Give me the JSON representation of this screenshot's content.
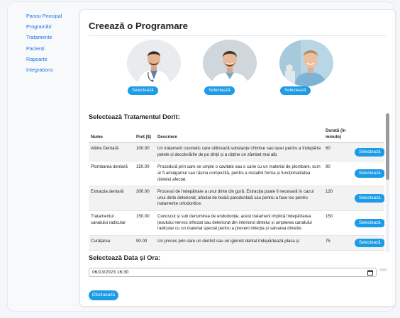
{
  "sidebar": {
    "items": [
      {
        "label": "Panou Principal"
      },
      {
        "label": "Programări"
      },
      {
        "label": "Tratamente"
      },
      {
        "label": "Pacienți"
      },
      {
        "label": "Rapoarte"
      },
      {
        "label": "Integrations"
      }
    ]
  },
  "main": {
    "title": "Creează o Programare",
    "doctors": [
      {
        "select_label": "Selectează"
      },
      {
        "select_label": "Selectează"
      },
      {
        "select_label": "Selectează"
      }
    ],
    "treatments": {
      "heading": "Selectează Tratamentul Dorit:",
      "columns": {
        "name": "Nume",
        "price": "Preț ($)",
        "description": "Descriere",
        "duration": "Durată (în minute)"
      },
      "rows": [
        {
          "name": "Albire Dentară",
          "price": "100.00",
          "description": "Un tratament cosmetic care utilizează substanțe chimice sau laser pentru a îndepărta petele și decolorările de pe dinții și a obține un zâmbet mai alb.",
          "duration": "60",
          "action": "Selectează"
        },
        {
          "name": "Plombarea dentară",
          "price": "150.00",
          "description": "Procedură prin care se umple o cavitate sau o carie cu un material de plombare, cum ar fi amalgamul sau rășina compozită, pentru a restabili forma și funcționalitatea dintelui afectat.",
          "duration": "90",
          "action": "Selectează"
        },
        {
          "name": "Extracția dentară",
          "price": "300.00",
          "description": "Procesul de îndepărtare a unui dinte din gură. Extracția poate fi necesară în cazul unui dinte deteriorat, afectat de boală parodontală sau pentru a face loc pentru tratamente ortodontice.",
          "duration": "120",
          "action": "Selectează"
        },
        {
          "name": "Tratamentul canalului radicular",
          "price": "150.00",
          "description": "Cunoscut și sub denumirea de endodonție, acest tratament implică îndepărtarea țesutului nervos infectat sau deteriorat din interiorul dintelui și umplerea canalului radicular cu un material special pentru a preveni infecția și salvarea dintelui.",
          "duration": "150",
          "action": "Selectează"
        },
        {
          "name": "Curățarea",
          "price": "90.00",
          "description": "Un proces prin care un dentist sau un igienist dental îndepărtează placa și",
          "duration": "75",
          "action": "Selectează"
        }
      ]
    },
    "datetime": {
      "heading": "Selectează Data și Ora:",
      "value": "06/13/2023 16:30"
    },
    "submit_label": "Efectuează"
  }
}
